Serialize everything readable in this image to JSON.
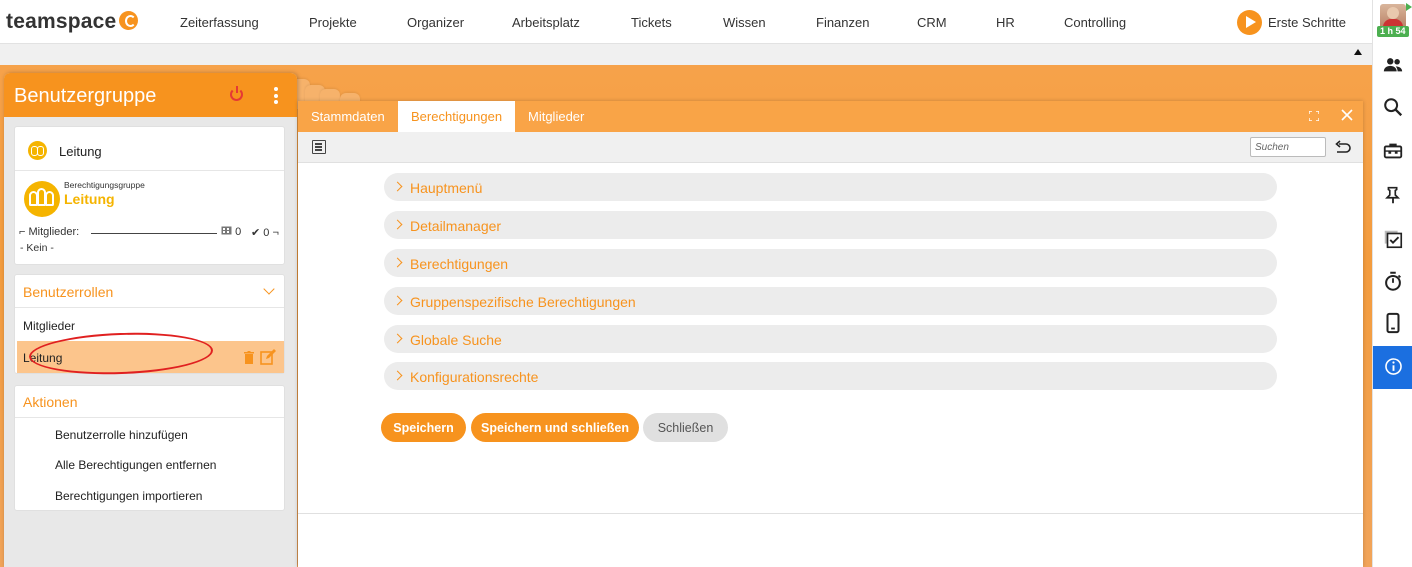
{
  "app": {
    "logo_text": "teamspace",
    "nav": [
      "Zeiterfassung",
      "Projekte",
      "Organizer",
      "Arbeitsplatz",
      "Tickets",
      "Wissen",
      "Finanzen",
      "CRM",
      "HR",
      "Controlling"
    ],
    "first_steps_label": "Erste Schritte",
    "timer_badge": "1 h 54"
  },
  "left_panel": {
    "title": "Benutzergruppe",
    "group_card": {
      "label": "Leitung",
      "subtitle": "Berechtigungsgruppe",
      "name": "Leitung",
      "members_label": "Mitglieder:",
      "count_a": "0",
      "count_b": "0",
      "members_value": "- Kein -"
    },
    "roles_card": {
      "title": "Benutzerrollen",
      "items": [
        "Mitglieder",
        "Leitung"
      ]
    },
    "actions_card": {
      "title": "Aktionen",
      "items": [
        "Benutzerrolle hinzufügen",
        "Alle Berechtigungen entfernen",
        "Berechtigungen importieren"
      ]
    }
  },
  "dialog": {
    "tabs": [
      "Stammdaten",
      "Berechtigungen",
      "Mitglieder"
    ],
    "active_tab": "Berechtigungen",
    "search_placeholder": "Suchen",
    "sections": [
      "Hauptmenü",
      "Detailmanager",
      "Berechtigungen",
      "Gruppenspezifische Berechtigungen",
      "Globale Suche",
      "Konfigurationsrechte"
    ],
    "buttons": {
      "save": "Speichern",
      "save_close": "Speichern und schließen",
      "close": "Schließen"
    }
  },
  "colors": {
    "accent": "#f7931e",
    "group_yellow": "#f5b400",
    "selected_row": "#fcc58c",
    "info_blue": "#1b6fe0",
    "annotation_red": "#e02020"
  }
}
